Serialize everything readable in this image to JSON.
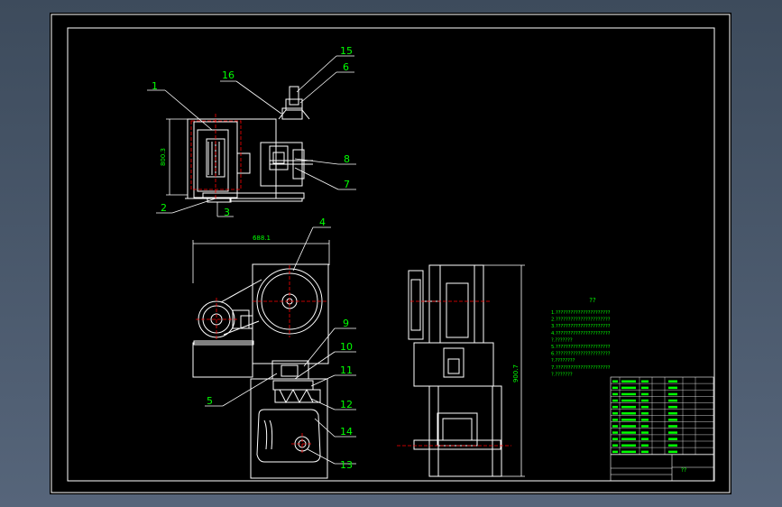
{
  "drawing": {
    "background": "#000000",
    "line_color": "#ffffff",
    "label_color": "#00ff00",
    "center_color": "#ff0000"
  },
  "callouts": {
    "n1": "1",
    "n2": "2",
    "n3": "3",
    "n4": "4",
    "n5": "5",
    "n6": "6",
    "n7": "7",
    "n8": "8",
    "n9": "9",
    "n10": "10",
    "n11": "11",
    "n12": "12",
    "n13": "13",
    "n14": "14",
    "n15": "15",
    "n16": "16"
  },
  "dimensions": {
    "top_height": "800.3",
    "front_width": "688.1",
    "side_height": "900.7"
  },
  "notes": {
    "heading": "??",
    "lines": [
      "1.??????????????????????",
      "2.??????????????????????",
      "3.??????????????????????",
      "4.??????????????????????",
      "?.???????",
      "5.??????????????????????",
      "6.??????????????????????",
      "?.????????",
      "7.??????????????????????",
      "?.???????"
    ]
  },
  "title_block": {
    "title": "??"
  }
}
